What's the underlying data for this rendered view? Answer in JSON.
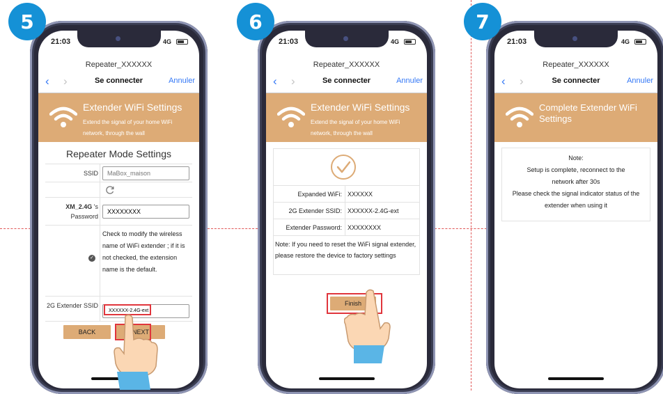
{
  "steps": [
    {
      "number": "5"
    },
    {
      "number": "6"
    },
    {
      "number": "7"
    }
  ],
  "status": {
    "time": "21:03",
    "network": "4G"
  },
  "browser": {
    "host": "Repeater_XXXXXX",
    "title": "Se connecter",
    "cancel": "Annuler",
    "back_glyph": "‹",
    "forward_glyph": "›"
  },
  "banner": {
    "title": "Extender WiFi Settings",
    "subtitle": "Extend the signal of your home WiFi network, through the wall",
    "complete_title": "Complete Extender WiFi Settings"
  },
  "screen5": {
    "form_title": "Repeater Mode Settings",
    "ssid_label": "SSID",
    "ssid_value": "MaBox_maison",
    "pass_label_bold": "XM_2.4G",
    "pass_label_rest": " 's Password",
    "pass_value": "XXXXXXXX",
    "check_text": "Check to modify the wireless name of WiFi extender ; if it is not checked, the extension name is the default.",
    "ext_ssid_label": "2G Extender SSID",
    "ext_ssid_value": "XXXXXX-2.4G-ext",
    "back_button": "BACK",
    "next_button": "NEXT"
  },
  "screen6": {
    "expanded_label": "Expanded WiFi:",
    "expanded_value": "XXXXXX",
    "ssid_label": "2G Extender SSID:",
    "ssid_value": "XXXXXX-2.4G-ext",
    "password_label": "Extender Password:",
    "password_value": "XXXXXXXX",
    "note": "Note: If you need to reset the WiFi signal extender, please restore the device to factory settings",
    "finish_button": "Finish"
  },
  "screen7": {
    "note_title": "Note:",
    "line1": "Setup is complete, reconnect to the network after 30s",
    "line2": "Please check the signal indicator status of the extender when using it"
  },
  "colors": {
    "badge": "#1591d6",
    "banner": "#ddab76",
    "highlight": "#e0353c",
    "link": "#3478f6",
    "phone_frame": "#8f95b4"
  }
}
